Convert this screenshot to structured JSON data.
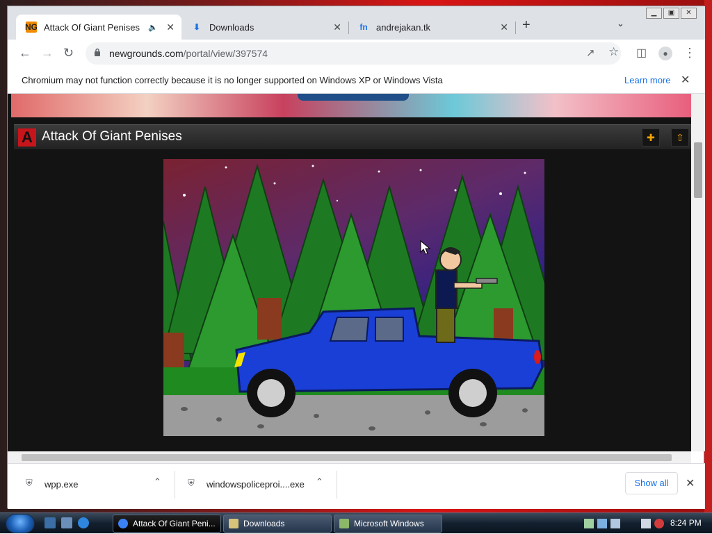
{
  "browser": {
    "tabs": [
      {
        "label": "Attack Of Giant Penises",
        "favicon": "newgrounds-icon",
        "active": true
      },
      {
        "label": "Downloads",
        "favicon": "download-icon",
        "active": false
      },
      {
        "label": "andrejakan.tk",
        "favicon": "fn-icon",
        "active": false
      }
    ],
    "newtab_glyph": "+",
    "address": {
      "host": "newgrounds.com",
      "path": "/portal/view/397574"
    }
  },
  "infobar": {
    "message": "Chromium may not function correctly because it is no longer supported on Windows XP or Windows Vista",
    "link": "Learn more"
  },
  "game": {
    "logo": "A",
    "title": "Attack Of Giant Penises",
    "colors": {
      "accent": "#f3a300",
      "brand": "#c8151b"
    }
  },
  "downloads": {
    "items": [
      {
        "name": "wpp.exe"
      },
      {
        "name": "windowspoliceproi....exe"
      }
    ],
    "show_all": "Show all"
  },
  "taskbar": {
    "tasks": [
      {
        "label": "Attack Of Giant Peni...",
        "active": true
      },
      {
        "label": "Downloads",
        "active": false
      },
      {
        "label": "Microsoft Windows",
        "active": false
      }
    ],
    "clock": "8:24 PM"
  }
}
